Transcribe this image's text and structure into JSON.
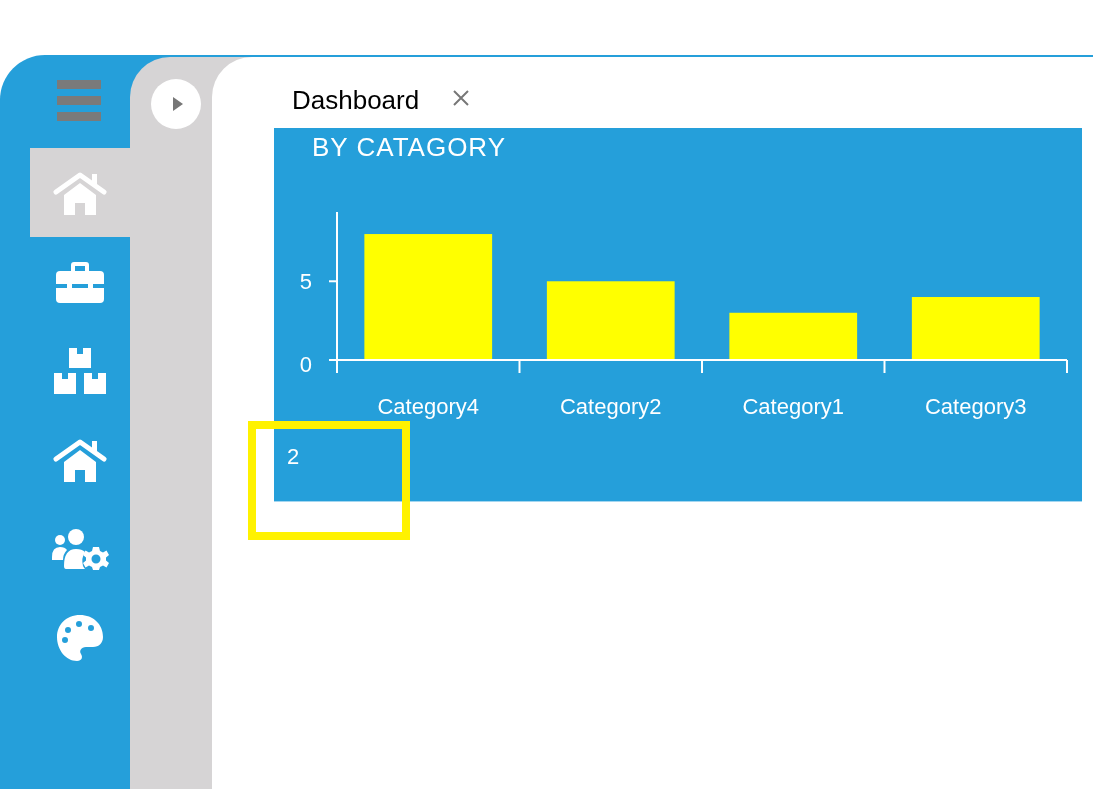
{
  "sidebar": {
    "items": [
      {
        "selected": true
      },
      {
        "selected": false
      },
      {
        "selected": false
      },
      {
        "selected": false
      },
      {
        "selected": false
      },
      {
        "selected": false
      }
    ]
  },
  "tabs": [
    {
      "label": "Dashboard",
      "selected": true
    }
  ],
  "chart_panel": {
    "title": "BY CATAGORY",
    "chart_data": {
      "type": "bar",
      "categories": [
        "Category4",
        "Category2",
        "Category1",
        "Category3"
      ],
      "values": [
        8,
        5,
        3,
        4
      ],
      "ylim": [
        0,
        9.4
      ],
      "yticks": [
        0,
        5
      ]
    },
    "footer": "2"
  }
}
